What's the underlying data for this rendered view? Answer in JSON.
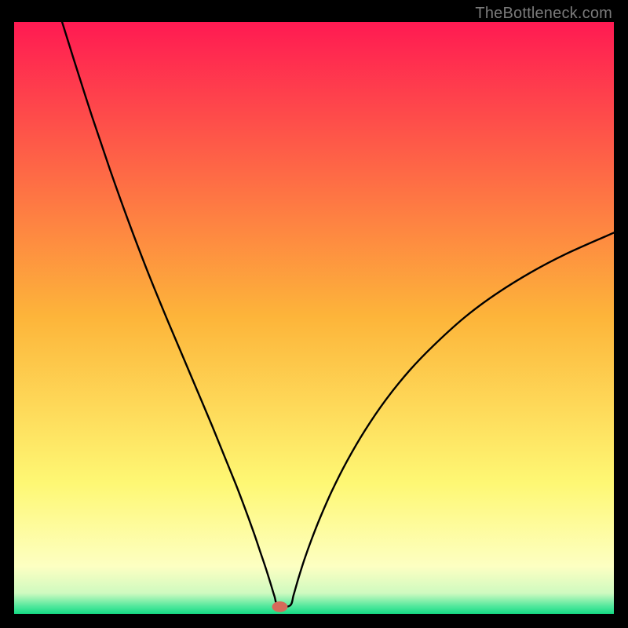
{
  "watermark": "TheBottleneck.com",
  "chart_data": {
    "type": "line",
    "title": "",
    "xlabel": "",
    "ylabel": "",
    "xlim": [
      0,
      100
    ],
    "ylim": [
      0,
      100
    ],
    "grid": false,
    "legend": false,
    "background_gradient": {
      "stops": [
        {
          "pos": 0.0,
          "color": "#ff1a52"
        },
        {
          "pos": 0.5,
          "color": "#fdb53a"
        },
        {
          "pos": 0.78,
          "color": "#fef874"
        },
        {
          "pos": 0.92,
          "color": "#fdffc2"
        },
        {
          "pos": 0.965,
          "color": "#cffac0"
        },
        {
          "pos": 0.988,
          "color": "#4de79b"
        },
        {
          "pos": 1.0,
          "color": "#16db84"
        }
      ]
    },
    "marker": {
      "x": 44.3,
      "y": 1.2,
      "rx": 1.3,
      "ry": 0.9,
      "color": "#d66a5a"
    },
    "series": [
      {
        "name": "curve",
        "color": "#000000",
        "width": 2.4,
        "x": [
          8.0,
          10.0,
          13.0,
          16.0,
          19.0,
          22.0,
          25.0,
          28.0,
          30.5,
          33.0,
          35.0,
          37.0,
          38.5,
          40.0,
          41.0,
          42.0,
          42.8,
          43.4,
          44.0,
          46.0,
          46.6,
          47.4,
          48.4,
          49.6,
          51.0,
          53.0,
          55.5,
          58.5,
          62.0,
          66.0,
          70.0,
          75.0,
          80.0,
          86.0,
          92.0,
          100.0
        ],
        "y": [
          100.0,
          93.5,
          84.0,
          75.0,
          66.5,
          58.5,
          51.0,
          43.8,
          37.8,
          31.8,
          26.8,
          21.8,
          17.8,
          13.6,
          10.6,
          7.6,
          5.0,
          3.0,
          1.4,
          1.4,
          3.2,
          6.0,
          9.2,
          12.6,
          16.2,
          20.8,
          25.8,
          31.0,
          36.2,
          41.2,
          45.4,
          50.0,
          53.8,
          57.6,
          60.8,
          64.4
        ]
      }
    ]
  }
}
